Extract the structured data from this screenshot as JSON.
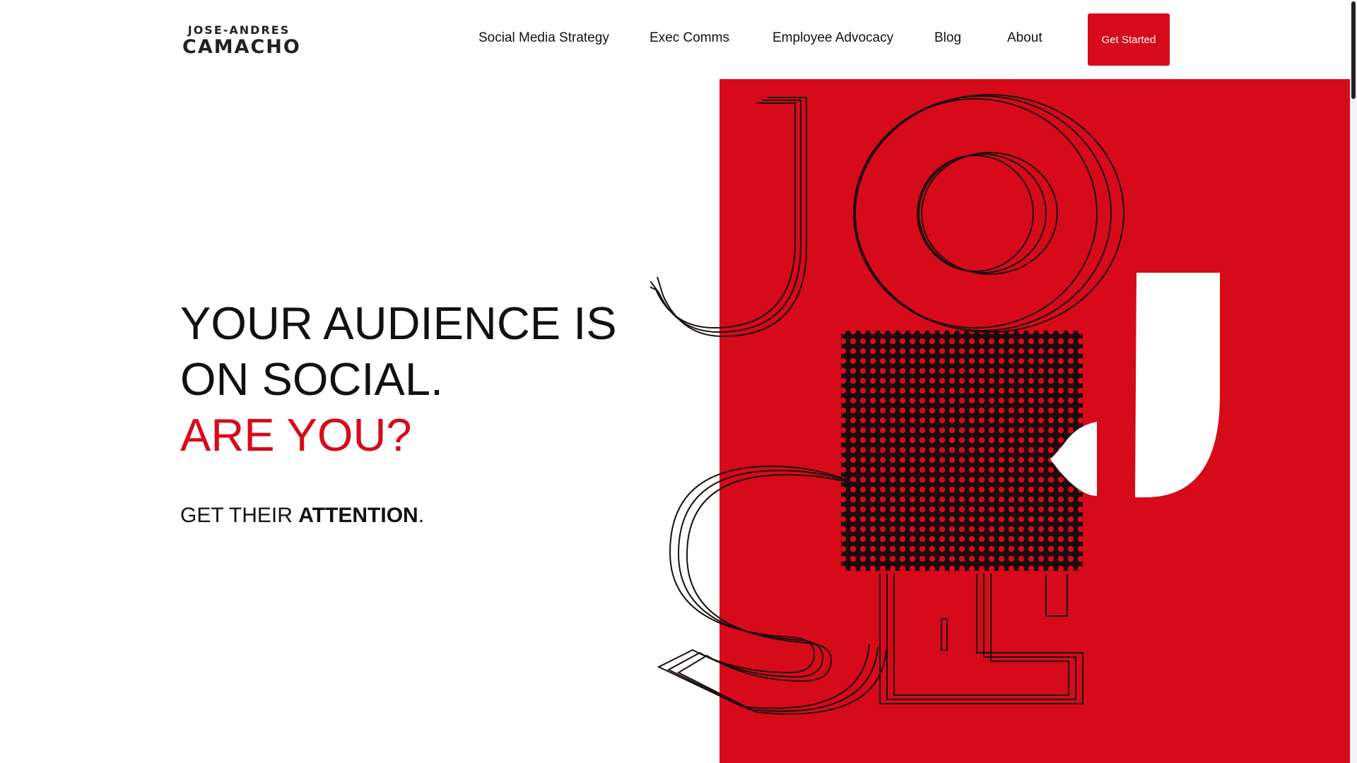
{
  "logo": {
    "line1": "JOSE-ANDRES",
    "line2": "CAMACHO"
  },
  "nav": {
    "items": [
      {
        "label": "Social Media Strategy"
      },
      {
        "label": "Exec Comms"
      },
      {
        "label": "Employee Advocacy"
      },
      {
        "label": "Blog"
      },
      {
        "label": "About"
      }
    ],
    "cta": "Get Started"
  },
  "hero": {
    "line1": "YOUR AUDIENCE IS",
    "line2": "ON SOCIAL.",
    "line3": "ARE YOU?",
    "tagline_prefix": "GET THEIR ",
    "tagline_bold": "ATTENTION",
    "tagline_suffix": "."
  },
  "colors": {
    "accent": "#d70a1a",
    "text": "#111111",
    "background": "#ffffff"
  }
}
